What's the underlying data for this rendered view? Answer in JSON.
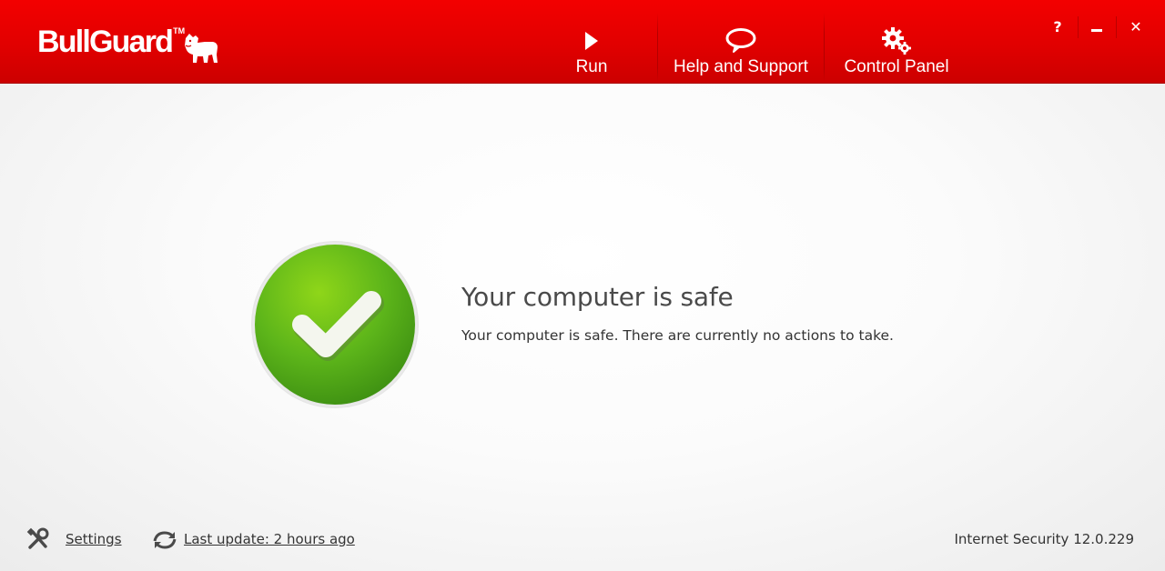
{
  "app": {
    "logo_text": "BullGuard",
    "logo_tm": "TM",
    "brand_color": "#e30000"
  },
  "nav": {
    "run": {
      "label": "Run",
      "icon": "play-icon"
    },
    "help": {
      "label": "Help and Support",
      "icon": "speech-bubble-icon"
    },
    "control_panel": {
      "label": "Control Panel",
      "icon": "gears-icon"
    }
  },
  "window_controls": {
    "help": "?",
    "close": "✕"
  },
  "status": {
    "title": "Your computer is safe",
    "message": "Your computer is safe. There are currently no actions to take.",
    "icon": "checkmark-icon",
    "color": "#4caf1a"
  },
  "footer": {
    "settings_label": "Settings",
    "update_label": "Last update: 2 hours ago",
    "version": "Internet Security 12.0.229"
  }
}
